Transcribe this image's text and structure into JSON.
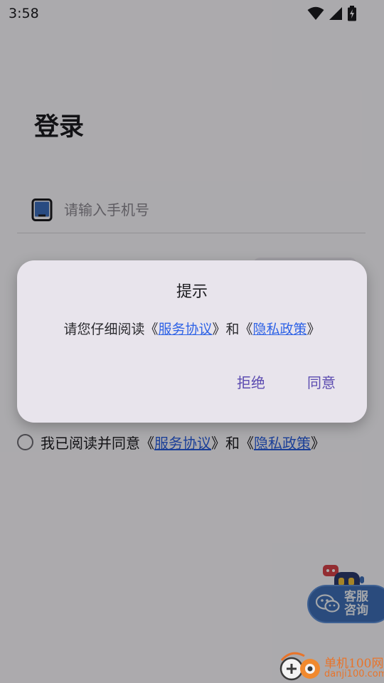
{
  "status_bar": {
    "time": "3:58"
  },
  "login": {
    "title": "登录",
    "phone_placeholder": "请输入手机号",
    "agreement": {
      "prefix": "我已阅读并同意《",
      "terms": "服务协议",
      "middle": "》和《",
      "privacy": "隐私政策",
      "suffix": "》"
    }
  },
  "dialog": {
    "title": "提示",
    "message_prefix": "请您仔细阅读《",
    "terms": "服务协议",
    "message_middle": "》和《",
    "privacy": "隐私政策",
    "message_suffix": "》",
    "reject_label": "拒绝",
    "agree_label": "同意"
  },
  "service_widget": {
    "line1": "客服",
    "line2": "咨询"
  },
  "watermark": {
    "name": "单机100网",
    "url": "danji100.com"
  },
  "colors": {
    "link": "#2a5fe0",
    "dialog_button": "#5b4bb0",
    "dialog_bg": "#e8e4ec",
    "service_pill": "#3f6fb8",
    "watermark": "#e8742a"
  },
  "icons": [
    "wifi-icon",
    "cellular-signal-icon",
    "battery-charging-icon",
    "phone-icon",
    "robot-mascot-icon",
    "wechat-chat-icon",
    "watermark-logo-icon"
  ]
}
